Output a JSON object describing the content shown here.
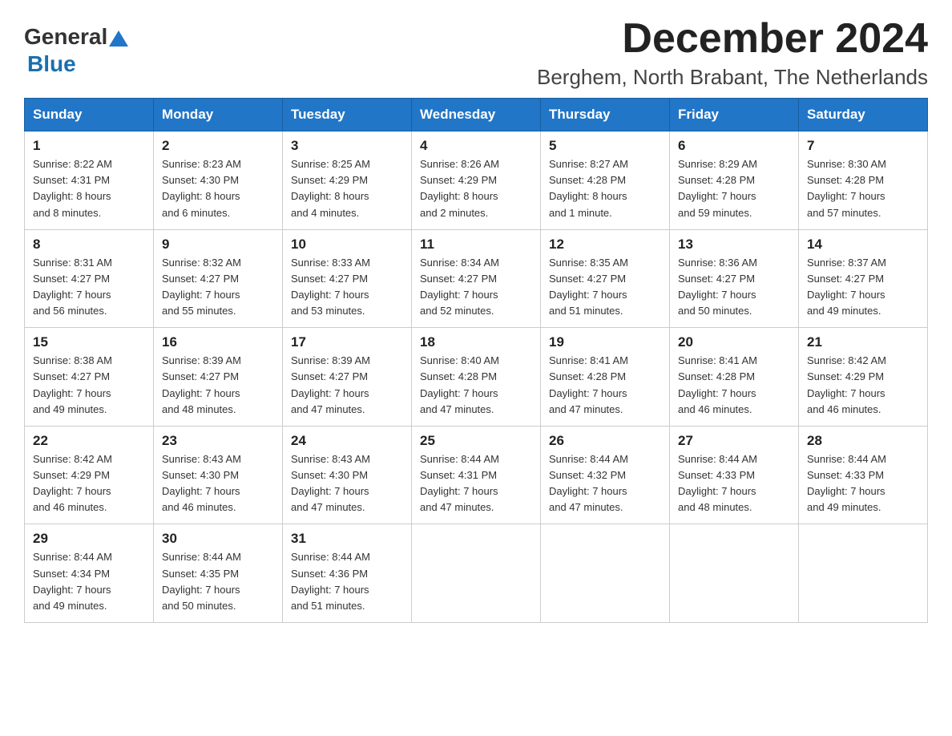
{
  "header": {
    "logo_general": "General",
    "logo_blue": "Blue",
    "month_title": "December 2024",
    "location": "Berghem, North Brabant, The Netherlands"
  },
  "days_of_week": [
    "Sunday",
    "Monday",
    "Tuesday",
    "Wednesday",
    "Thursday",
    "Friday",
    "Saturday"
  ],
  "weeks": [
    [
      {
        "day": "1",
        "sunrise": "8:22 AM",
        "sunset": "4:31 PM",
        "daylight": "8 hours and 8 minutes."
      },
      {
        "day": "2",
        "sunrise": "8:23 AM",
        "sunset": "4:30 PM",
        "daylight": "8 hours and 6 minutes."
      },
      {
        "day": "3",
        "sunrise": "8:25 AM",
        "sunset": "4:29 PM",
        "daylight": "8 hours and 4 minutes."
      },
      {
        "day": "4",
        "sunrise": "8:26 AM",
        "sunset": "4:29 PM",
        "daylight": "8 hours and 2 minutes."
      },
      {
        "day": "5",
        "sunrise": "8:27 AM",
        "sunset": "4:28 PM",
        "daylight": "8 hours and 1 minute."
      },
      {
        "day": "6",
        "sunrise": "8:29 AM",
        "sunset": "4:28 PM",
        "daylight": "7 hours and 59 minutes."
      },
      {
        "day": "7",
        "sunrise": "8:30 AM",
        "sunset": "4:28 PM",
        "daylight": "7 hours and 57 minutes."
      }
    ],
    [
      {
        "day": "8",
        "sunrise": "8:31 AM",
        "sunset": "4:27 PM",
        "daylight": "7 hours and 56 minutes."
      },
      {
        "day": "9",
        "sunrise": "8:32 AM",
        "sunset": "4:27 PM",
        "daylight": "7 hours and 55 minutes."
      },
      {
        "day": "10",
        "sunrise": "8:33 AM",
        "sunset": "4:27 PM",
        "daylight": "7 hours and 53 minutes."
      },
      {
        "day": "11",
        "sunrise": "8:34 AM",
        "sunset": "4:27 PM",
        "daylight": "7 hours and 52 minutes."
      },
      {
        "day": "12",
        "sunrise": "8:35 AM",
        "sunset": "4:27 PM",
        "daylight": "7 hours and 51 minutes."
      },
      {
        "day": "13",
        "sunrise": "8:36 AM",
        "sunset": "4:27 PM",
        "daylight": "7 hours and 50 minutes."
      },
      {
        "day": "14",
        "sunrise": "8:37 AM",
        "sunset": "4:27 PM",
        "daylight": "7 hours and 49 minutes."
      }
    ],
    [
      {
        "day": "15",
        "sunrise": "8:38 AM",
        "sunset": "4:27 PM",
        "daylight": "7 hours and 49 minutes."
      },
      {
        "day": "16",
        "sunrise": "8:39 AM",
        "sunset": "4:27 PM",
        "daylight": "7 hours and 48 minutes."
      },
      {
        "day": "17",
        "sunrise": "8:39 AM",
        "sunset": "4:27 PM",
        "daylight": "7 hours and 47 minutes."
      },
      {
        "day": "18",
        "sunrise": "8:40 AM",
        "sunset": "4:28 PM",
        "daylight": "7 hours and 47 minutes."
      },
      {
        "day": "19",
        "sunrise": "8:41 AM",
        "sunset": "4:28 PM",
        "daylight": "7 hours and 47 minutes."
      },
      {
        "day": "20",
        "sunrise": "8:41 AM",
        "sunset": "4:28 PM",
        "daylight": "7 hours and 46 minutes."
      },
      {
        "day": "21",
        "sunrise": "8:42 AM",
        "sunset": "4:29 PM",
        "daylight": "7 hours and 46 minutes."
      }
    ],
    [
      {
        "day": "22",
        "sunrise": "8:42 AM",
        "sunset": "4:29 PM",
        "daylight": "7 hours and 46 minutes."
      },
      {
        "day": "23",
        "sunrise": "8:43 AM",
        "sunset": "4:30 PM",
        "daylight": "7 hours and 46 minutes."
      },
      {
        "day": "24",
        "sunrise": "8:43 AM",
        "sunset": "4:30 PM",
        "daylight": "7 hours and 47 minutes."
      },
      {
        "day": "25",
        "sunrise": "8:44 AM",
        "sunset": "4:31 PM",
        "daylight": "7 hours and 47 minutes."
      },
      {
        "day": "26",
        "sunrise": "8:44 AM",
        "sunset": "4:32 PM",
        "daylight": "7 hours and 47 minutes."
      },
      {
        "day": "27",
        "sunrise": "8:44 AM",
        "sunset": "4:33 PM",
        "daylight": "7 hours and 48 minutes."
      },
      {
        "day": "28",
        "sunrise": "8:44 AM",
        "sunset": "4:33 PM",
        "daylight": "7 hours and 49 minutes."
      }
    ],
    [
      {
        "day": "29",
        "sunrise": "8:44 AM",
        "sunset": "4:34 PM",
        "daylight": "7 hours and 49 minutes."
      },
      {
        "day": "30",
        "sunrise": "8:44 AM",
        "sunset": "4:35 PM",
        "daylight": "7 hours and 50 minutes."
      },
      {
        "day": "31",
        "sunrise": "8:44 AM",
        "sunset": "4:36 PM",
        "daylight": "7 hours and 51 minutes."
      },
      null,
      null,
      null,
      null
    ]
  ],
  "labels": {
    "sunrise": "Sunrise:",
    "sunset": "Sunset:",
    "daylight": "Daylight:"
  }
}
